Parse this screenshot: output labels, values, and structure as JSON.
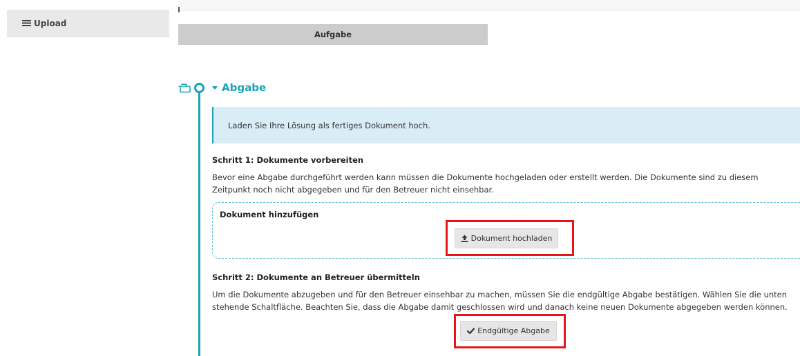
{
  "sidebar": {
    "upload_label": "Upload",
    "upload_icon": "list-icon"
  },
  "task_button_label": "Aufgabe",
  "section": {
    "title": "Abgabe",
    "accent_color": "#1aa3b8"
  },
  "info_message": "Laden Sie Ihre Lösung als fertiges Dokument hoch.",
  "step1": {
    "heading": "Schritt 1: Dokumente vorbereiten",
    "text": "Bevor eine Abgabe durchgeführt werden kann müssen die Dokumente hochgeladen oder erstellt werden. Die Dokumente sind zu diesem Zeitpunkt noch nicht abgegeben und für den Betreuer nicht einsehbar.",
    "add_document_title": "Dokument hinzufügen",
    "upload_button_label": "Dokument hochladen"
  },
  "step2": {
    "heading": "Schritt 2: Dokumente an Betreuer übermitteln",
    "text": "Um die Dokumente abzugeben und für den Betreuer einsehbar zu machen, müssen Sie die endgültige Abgabe bestätigen. Wählen Sie die unten stehende Schaltfläche. Beachten Sie, dass die Abgabe damit geschlossen wird und danach keine neuen Dokumente abgegeben werden können.",
    "final_button_label": "Endgültige Abgabe"
  },
  "highlight_color": "#e8141a"
}
